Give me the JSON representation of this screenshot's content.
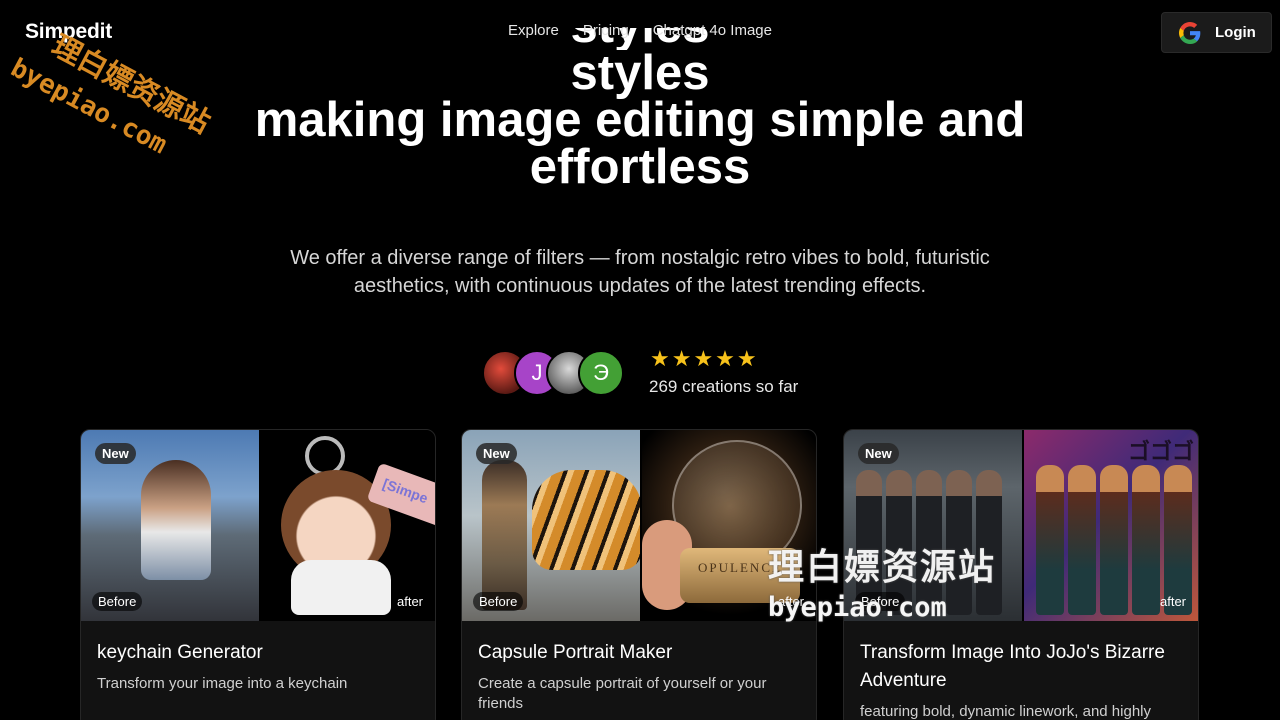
{
  "nav": {
    "brand": "Simpedit",
    "links": [
      "Explore",
      "Pricing",
      "Chatgpt 4o Image"
    ],
    "login_label": "Login"
  },
  "watermark": {
    "cn": "理白嫖资源站",
    "url": "byepiao.com"
  },
  "hero": {
    "title_line_clipped": "styles",
    "title_line_1": "styles",
    "title_line_2": "making image editing simple and",
    "title_line_3": "effortless",
    "subtitle": "We offer a diverse range of filters — from nostalgic retro vibes to bold, futuristic aesthetics, with continuous updates of the latest trending effects."
  },
  "social_proof": {
    "avatars": [
      "",
      "J",
      "",
      "Э"
    ],
    "rating_stars": 5,
    "stars_text": "★★★★★",
    "creations_text": "269 creations so far"
  },
  "cards": [
    {
      "badge": "New",
      "before_label": "Before",
      "after_label": "after",
      "title": "keychain Generator",
      "description": "Transform your image into a keychain",
      "tag_text": "[Simpe"
    },
    {
      "badge": "New",
      "before_label": "Before",
      "after_label": "after",
      "title": "Capsule Portrait Maker",
      "description": "Create a capsule portrait of yourself or your friends",
      "product_text": "OPULENCE"
    },
    {
      "badge": "New",
      "before_label": "Before",
      "after_label": "after",
      "title": "Transform Image Into JoJo's Bizarre Adventure",
      "description": "featuring bold, dynamic linework, and highly",
      "sfx_text": "ゴゴゴ"
    }
  ],
  "colors": {
    "background": "#000000",
    "star": "#f7c21b",
    "card_bg": "#121212",
    "watermark_orange": "#d88a23"
  }
}
